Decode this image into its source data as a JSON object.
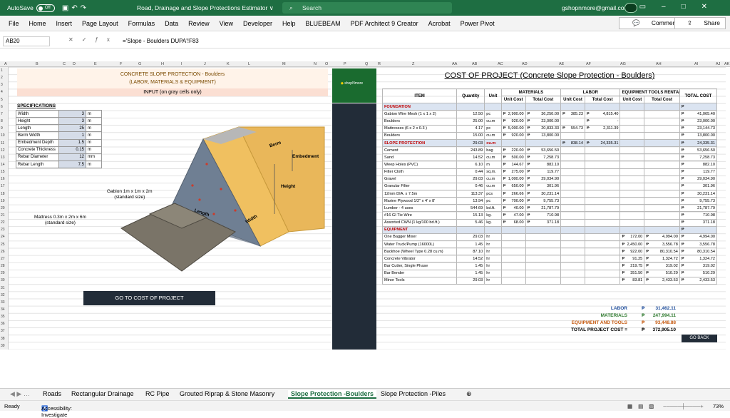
{
  "titlebar": {
    "autosave_label": "AutoSave",
    "autosave_state": "Off",
    "doc_title": "Road, Drainage and Slope Protections Estimator ∨",
    "search_placeholder": "Search",
    "user_email": "gshopnmore@gmail.com"
  },
  "menu": [
    "File",
    "Home",
    "Insert",
    "Page Layout",
    "Formulas",
    "Data",
    "Review",
    "View",
    "Developer",
    "Help",
    "BLUEBEAM",
    "PDF Architect 9 Creator",
    "Acrobat",
    "Power Pivot"
  ],
  "comments_label": "Comments",
  "share_label": "Share",
  "formula": {
    "cell": "AB20",
    "text": "='Slope - Boulders DUPA'!F83"
  },
  "columns": [
    "A",
    "B",
    "C",
    "D",
    "E",
    "F",
    "G",
    "H",
    "I",
    "J",
    "K",
    "L",
    "M",
    "N",
    "O",
    "P",
    "Q",
    "R",
    "Z",
    "AA",
    "AB",
    "AC",
    "AD",
    "AE",
    "AF",
    "AG",
    "AH",
    "AI",
    "AJ",
    "AK"
  ],
  "left": {
    "title1": "CONCRETE SLOPE PROTECTION - Boulders",
    "title2": "(LABOR, MATERIALS & EQUIPMENT)",
    "input_note": "INPUT (on gray cells only)",
    "spec_heading": "SPECIFICATIONS",
    "specs": [
      {
        "label": "Width",
        "value": "3",
        "unit": "m"
      },
      {
        "label": "Height",
        "value": "3",
        "unit": "m"
      },
      {
        "label": "Length",
        "value": "25",
        "unit": "m"
      },
      {
        "label": "Berm Width",
        "value": "1",
        "unit": "m"
      },
      {
        "label": "Embedment Depth",
        "value": "1.5",
        "unit": "m"
      },
      {
        "label": "Concrete Thickness",
        "value": "0.15",
        "unit": "m"
      },
      {
        "label": "Rebar Diameter",
        "value": "12",
        "unit": "mm"
      },
      {
        "label": "Rebar Length",
        "value": "7.5",
        "unit": "m"
      }
    ],
    "diagram": {
      "berm": "Berm",
      "embedment": "Embedment",
      "height": "Height",
      "length": "Length",
      "width": "Width",
      "gabion": "Gabion 1m x 1m x 2m",
      "gabion_note": "(standard size)",
      "mattress": "Mattress 0.3m x 2m x 6m",
      "mattress_note": "(standard size)"
    },
    "go_button": "GO TO COST OF PROJECT"
  },
  "logo": {
    "brand": "shopNmore"
  },
  "cost": {
    "title": "COST OF PROJECT (Concrete Slope Protection - Boulders)",
    "headers": {
      "item": "ITEM",
      "qty": "Quantity",
      "unit": "Unit",
      "materials": "MATERIALS",
      "labor": "LABOR",
      "equip": "EQUIPMENT TOOLS RENTAL",
      "total": "TOTAL COST",
      "unit_cost": "Unit Cost",
      "total_cost": "Total Cost"
    },
    "rows": [
      {
        "type": "sec",
        "item": "FOUNDATION",
        "total": ""
      },
      {
        "item": "Gabion Wire Mesh (1 x 1 x 2)",
        "qty": "12.50",
        "unit": "pc",
        "mu": "2,900.00",
        "mt": "36,250.00",
        "lu": "385.23",
        "lt": "4,815.40",
        "eu": "",
        "et": "",
        "total": "41,065.40"
      },
      {
        "item": "Boulders",
        "qty": "25.00",
        "unit": "cu.m",
        "mu": "920.00",
        "mt": "23,000.00",
        "lu": "",
        "lt": "-",
        "eu": "",
        "et": "",
        "total": "23,000.00"
      },
      {
        "item": "Mattresses (6 x 2 x 0.3 )",
        "qty": "4.17",
        "unit": "pc",
        "mu": "5,000.00",
        "mt": "20,833.33",
        "lu": "554.73",
        "lt": "2,311.39",
        "eu": "",
        "et": "",
        "total": "23,144.73"
      },
      {
        "item": "Boulders",
        "qty": "15.00",
        "unit": "cu.m",
        "mu": "920.00",
        "mt": "13,800.00",
        "lu": "",
        "lt": "",
        "eu": "",
        "et": "",
        "total": "13,800.00"
      },
      {
        "type": "sec",
        "item": "SLOPE PROTECTION",
        "qty": "29.03",
        "unit": "cu.m",
        "lu": "838.14",
        "lt": "24,335.31",
        "total": "24,335.31"
      },
      {
        "item": "Cement",
        "qty": "243.89",
        "unit": "bag",
        "mu": "220.00",
        "mt": "53,656.50",
        "lu": "",
        "lt": "",
        "eu": "",
        "et": "",
        "total": "53,656.50"
      },
      {
        "item": "Sand",
        "qty": "14.52",
        "unit": "cu.m",
        "mu": "500.00",
        "mt": "7,258.73",
        "lu": "",
        "lt": "",
        "eu": "",
        "et": "",
        "total": "7,258.73"
      },
      {
        "item": "Weep Holes (PVC)",
        "qty": "6.10",
        "unit": "m",
        "mu": "144.67",
        "mt": "882.10",
        "lu": "",
        "lt": "",
        "eu": "",
        "et": "",
        "total": "882.10"
      },
      {
        "item": "Filter Cloth",
        "qty": "0.44",
        "unit": "sq.m.",
        "mu": "275.00",
        "mt": "119.77",
        "lu": "",
        "lt": "",
        "eu": "",
        "et": "",
        "total": "119.77"
      },
      {
        "item": "Gravel",
        "qty": "29.03",
        "unit": "cu.m",
        "mu": "1,000.00",
        "mt": "29,034.90",
        "lu": "",
        "lt": "",
        "eu": "",
        "et": "",
        "total": "29,034.90"
      },
      {
        "item": "Granular Filter",
        "qty": "0.46",
        "unit": "cu.m",
        "mu": "650.00",
        "mt": "301.96",
        "lu": "",
        "lt": "",
        "eu": "",
        "et": "",
        "total": "301.96"
      },
      {
        "item": "12mm DIA. x 7.5m",
        "qty": "113.37",
        "unit": "pcs",
        "mu": "266.66",
        "mt": "30,231.14",
        "lu": "",
        "lt": "",
        "eu": "",
        "et": "",
        "total": "30,231.14"
      },
      {
        "item": "Marine Plywood 1/2\" x 4' x 8'",
        "qty": "13.94",
        "unit": "pc",
        "mu": "700.00",
        "mt": "9,755.73",
        "lu": "",
        "lt": "",
        "eu": "",
        "et": "",
        "total": "9,755.73"
      },
      {
        "item": "Lumber - 4 uses",
        "qty": "544.69",
        "unit": "bd.ft.",
        "mu": "40.00",
        "mt": "21,787.79",
        "lu": "",
        "lt": "",
        "eu": "",
        "et": "",
        "total": "21,787.79"
      },
      {
        "item": "#16 GI Tie Wire",
        "qty": "15.13",
        "unit": "kg.",
        "mu": "47.00",
        "mt": "710.98",
        "lu": "",
        "lt": "",
        "eu": "",
        "et": "",
        "total": "710.98"
      },
      {
        "item": "Assorted CWN (1 kg/100 bd.ft.)",
        "qty": "5.46",
        "unit": "kg.",
        "mu": "68.00",
        "mt": "371.18",
        "lu": "",
        "lt": "",
        "eu": "",
        "et": "",
        "total": "371.18"
      },
      {
        "type": "sec",
        "item": "EQUIPMENT",
        "total": ""
      },
      {
        "item": "One Bagger Mixer",
        "qty": "29.03",
        "unit": "hr",
        "mu": "",
        "mt": "",
        "lu": "",
        "lt": "",
        "eu": "172.00",
        "et": "4,994.00",
        "total": "4,994.00"
      },
      {
        "item": "Water Truck/Pump (16000L)",
        "qty": "1.45",
        "unit": "hr",
        "mu": "",
        "mt": "",
        "lu": "",
        "lt": "",
        "eu": "2,450.00",
        "et": "3,556.78",
        "total": "3,556.78"
      },
      {
        "item": "Backhoe (Wheel Type 0.28 cu.m)",
        "qty": "87.10",
        "unit": "hr",
        "mu": "",
        "mt": "",
        "lu": "",
        "lt": "",
        "eu": "922.00",
        "et": "80,310.54",
        "total": "80,310.54"
      },
      {
        "item": "Concrete Vibrator",
        "qty": "14.52",
        "unit": "hr",
        "mu": "",
        "mt": "",
        "lu": "",
        "lt": "",
        "eu": "91.25",
        "et": "1,324.72",
        "total": "1,324.72"
      },
      {
        "item": "Bar Cutter, Single Phase",
        "qty": "1.45",
        "unit": "hr",
        "mu": "",
        "mt": "",
        "lu": "",
        "lt": "",
        "eu": "219.75",
        "et": "319.02",
        "total": "319.02"
      },
      {
        "item": "Bar Bender",
        "qty": "1.45",
        "unit": "hr",
        "mu": "",
        "mt": "",
        "lu": "",
        "lt": "",
        "eu": "351.50",
        "et": "510.29",
        "total": "510.29"
      },
      {
        "item": "Minor Tools",
        "qty": "29.03",
        "unit": "hr",
        "mu": "",
        "mt": "",
        "lu": "",
        "lt": "",
        "eu": "83.81",
        "et": "2,433.53",
        "total": "2,433.53"
      }
    ],
    "peso": "₱",
    "summary": [
      {
        "label": "LABOR",
        "value": "31,462.11",
        "color": "#1f4e9c"
      },
      {
        "label": "MATERIALS",
        "value": "247,994.11",
        "color": "#2f7a2f"
      },
      {
        "label": "EQUIPMENT AND TOOLS",
        "value": "93,448.88",
        "color": "#c55a11"
      },
      {
        "label": "TOTAL PROJECT COST =",
        "value": "372,905.10",
        "color": "#000000"
      }
    ],
    "go_back": "GO BACK"
  },
  "sheets": [
    "Roads",
    "Rectangular Drainage",
    "RC Pipe",
    "Grouted Riprap & Stone Masonry",
    "Slope Protection -Boulders",
    "Slope Protection -Piles"
  ],
  "active_sheet": 4,
  "status": {
    "ready": "Ready",
    "accessibility": "Accessibility: Investigate",
    "zoom": "73%"
  }
}
